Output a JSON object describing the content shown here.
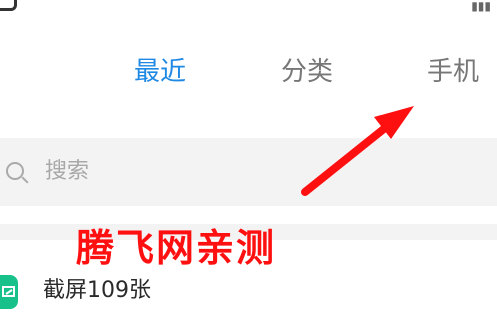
{
  "tabs": [
    {
      "label": "最近",
      "active": true
    },
    {
      "label": "分类",
      "active": false
    },
    {
      "label": "手机",
      "active": false
    }
  ],
  "search": {
    "placeholder": "搜索",
    "icon": "search-icon"
  },
  "list": [
    {
      "label": "截屏109张",
      "icon": "screenshot-icon"
    }
  ],
  "annotation": {
    "watermark": "腾飞网亲测",
    "color": "#ff1010"
  },
  "colors": {
    "accent": "#1e88e5",
    "icon_green": "#18c08a"
  }
}
